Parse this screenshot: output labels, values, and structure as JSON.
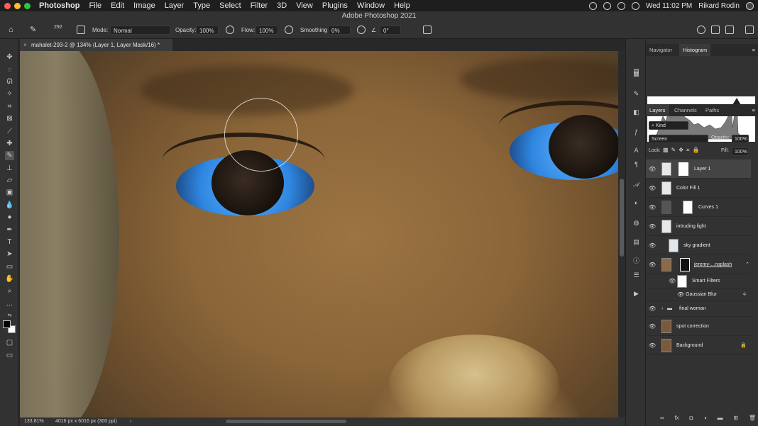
{
  "menubar": {
    "app_name": "Photoshop",
    "items": [
      "File",
      "Edit",
      "Image",
      "Layer",
      "Type",
      "Select",
      "Filter",
      "3D",
      "View",
      "Plugins",
      "Window",
      "Help"
    ],
    "clock": "Wed 11:02 PM",
    "user": "Rikard Rodin"
  },
  "window": {
    "title": "Adobe Photoshop 2021"
  },
  "options": {
    "brush_size": "292",
    "mode_label": "Mode:",
    "mode_value": "Normal",
    "opacity_label": "Opacity:",
    "opacity_value": "100%",
    "flow_label": "Flow:",
    "flow_value": "100%",
    "smoothing_label": "Smoothing:",
    "smoothing_value": "0%",
    "angle_value": "0°"
  },
  "document": {
    "tab_title": "mahalet-293-2 @ 134% (Layer 1, Layer Mask/16) *",
    "close_symbol": "×"
  },
  "status": {
    "zoom": "133.81%",
    "dimensions": "4016 px x 6016 px (300 ppi)",
    "arrow": "›"
  },
  "panels": {
    "top_tabs": [
      "Navigator",
      "Histogram"
    ],
    "layers_tabs": [
      "Layers",
      "Channels",
      "Paths"
    ],
    "filter_kind": "Kind",
    "blend_mode": "Screen",
    "opacity_label": "Opacity:",
    "opacity_value": "100%",
    "lock_label": "Lock:",
    "fill_label": "Fill:",
    "fill_value": "100%",
    "layers": [
      {
        "name": "Layer 1"
      },
      {
        "name": "Color Fill 1"
      },
      {
        "name": "Curves 1"
      },
      {
        "name": "intruding light"
      },
      {
        "name": "sky gradient"
      },
      {
        "name": "jeremy-...nsplash"
      },
      {
        "name": "Smart Filters"
      },
      {
        "name": "Gaussian Blur"
      },
      {
        "name": "final woman"
      },
      {
        "name": "spot correction"
      },
      {
        "name": "Background"
      }
    ]
  },
  "colors": {
    "accent": "#2f86e0",
    "panel_bg": "#323232",
    "canvas_bg": "#282828"
  }
}
